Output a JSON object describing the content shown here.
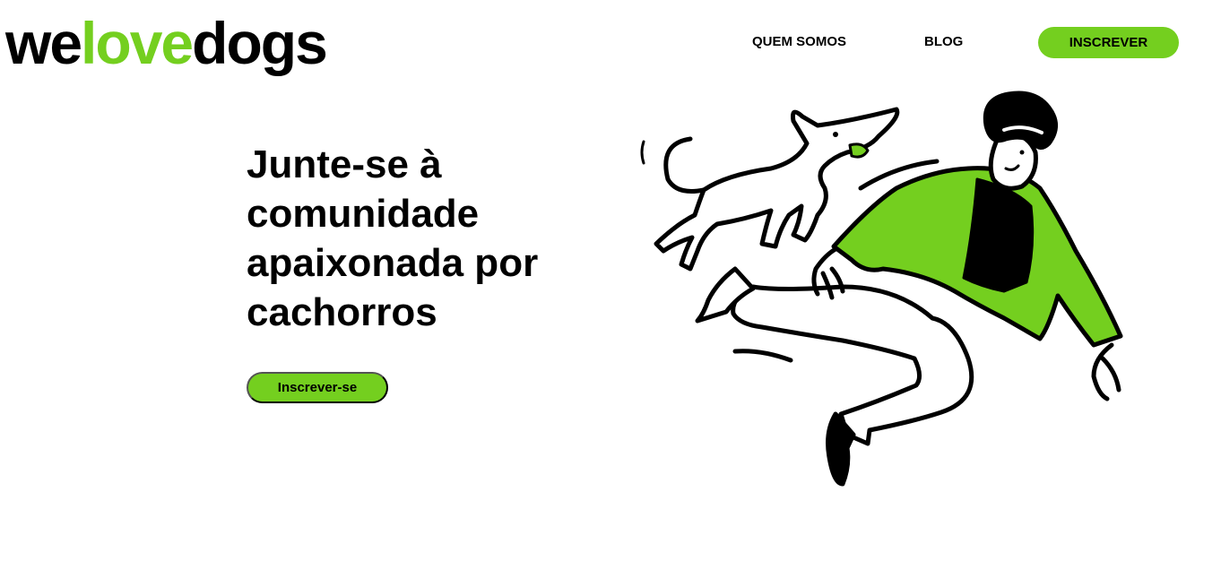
{
  "logo": {
    "part1": "we",
    "part2": "love",
    "part3": "dogs"
  },
  "nav": {
    "items": [
      {
        "label": "QUEM SOMOS"
      },
      {
        "label": "BLOG"
      }
    ],
    "cta_label": "INSCREVER"
  },
  "hero": {
    "title": "Junte-se à comunidade apaixonada por cachorros",
    "cta_label": "Inscrever-se"
  },
  "colors": {
    "accent": "#74cf1f",
    "text": "#000000",
    "background": "#ffffff"
  },
  "illustration": {
    "icon": "person-running-with-dog-illustration"
  }
}
